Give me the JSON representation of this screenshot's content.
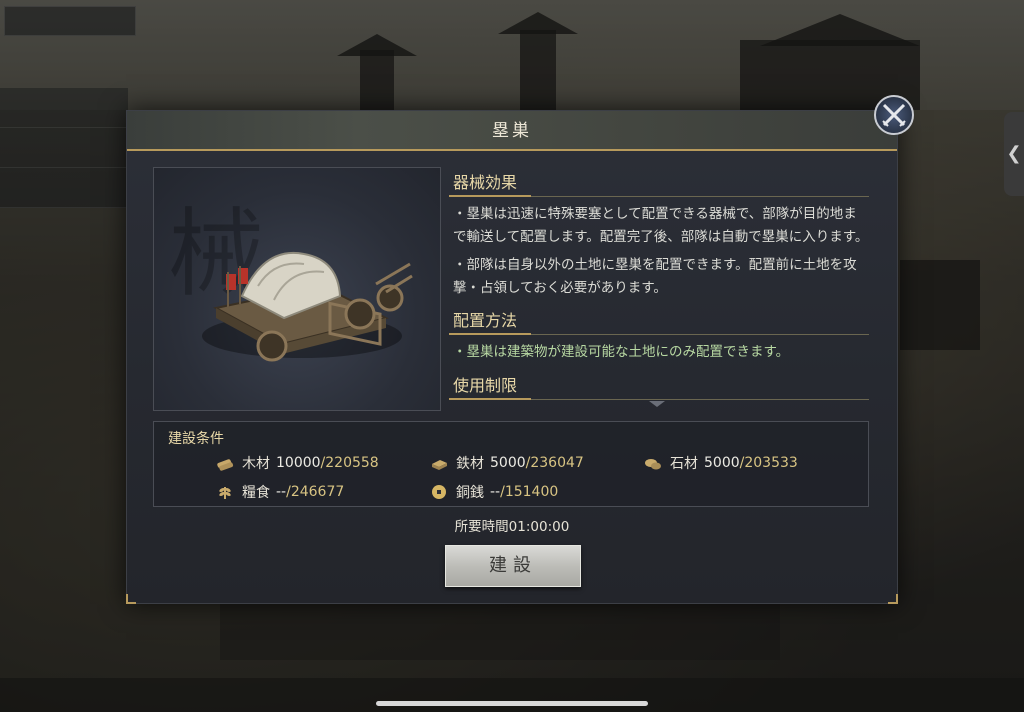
{
  "dialog": {
    "title": "塁巣",
    "sections": [
      {
        "heading": "器械効果",
        "paragraphs": [
          "・塁巣は迅速に特殊要塞として配置できる器械で、部隊が目的地まで輸送して配置します。配置完了後、部隊は自動で塁巣に入ります。",
          "・部隊は自身以外の土地に塁巣を配置できます。配置前に土地を攻撃・占領しておく必要があります。"
        ]
      },
      {
        "heading": "配置方法",
        "paragraphs": [
          "・塁巣は建築物が建設可能な土地にのみ配置できます。"
        ]
      },
      {
        "heading": "使用制限",
        "paragraphs": []
      }
    ],
    "conditions": {
      "title": "建設条件",
      "resources": [
        {
          "icon": "wood-icon",
          "name": "木材",
          "required": "10000",
          "owned": "/220558"
        },
        {
          "icon": "iron-icon",
          "name": "鉄材",
          "required": "5000",
          "owned": "/236047"
        },
        {
          "icon": "stone-icon",
          "name": "石材",
          "required": "5000",
          "owned": "/203533"
        },
        {
          "icon": "grain-icon",
          "name": "糧食",
          "required": "--",
          "owned": "/246677"
        },
        {
          "icon": "coin-icon",
          "name": "銅銭",
          "required": "--",
          "owned": "/151400"
        }
      ]
    },
    "time_label": "所要時間01:00:00",
    "build_label": "建設"
  },
  "colors": {
    "accent_gold": "#b79a5c",
    "owned_amount": "#d8c483",
    "green_text": "#b8d9a3"
  }
}
